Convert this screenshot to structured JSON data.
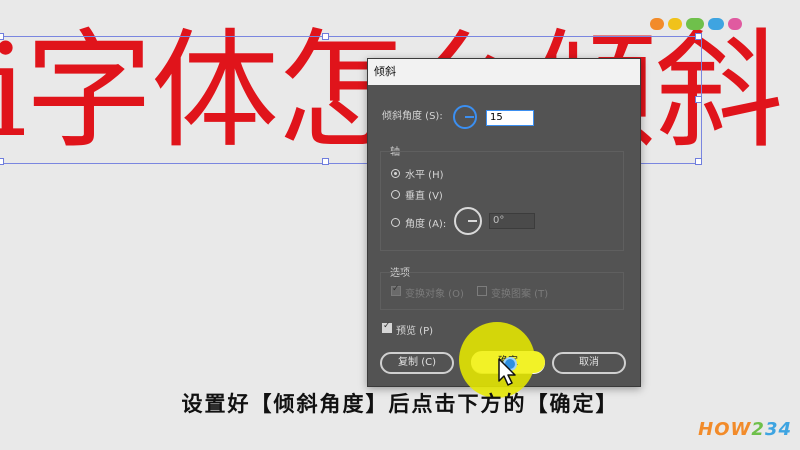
{
  "canvas": {
    "headline_text": "i字体怎么倾斜",
    "text_color": "#e0141b",
    "selection_color": "#7a86e0"
  },
  "dialog": {
    "title": "倾斜",
    "shear_angle_label": "倾斜角度 (S):",
    "shear_angle_value": "15",
    "axis_group_title": "轴",
    "axis_options": [
      {
        "label": "水平 (H)",
        "selected": true
      },
      {
        "label": "垂直 (V)",
        "selected": false
      },
      {
        "label": "角度 (A):",
        "selected": false
      }
    ],
    "axis_angle_value": "0°",
    "options_group_title": "选项",
    "transform_objects_label": "变换对象 (O)",
    "transform_patterns_label": "变换图案 (T)",
    "preview_label": "预览 (P)",
    "buttons": {
      "copy": "复制 (C)",
      "ok": "确定",
      "cancel": "取消"
    },
    "accent_color": "#3b8ff1",
    "background_color": "#535353"
  },
  "overlay": {
    "subtitle": "设置好【倾斜角度】后点击下方的【确定】",
    "highlight_color": "#e6e800"
  },
  "brand": {
    "logo_parts": [
      "HOW",
      "2",
      "34"
    ]
  },
  "icons": [
    "dial-icon",
    "cursor-icon",
    "radio-icon",
    "checkbox-icon"
  ]
}
